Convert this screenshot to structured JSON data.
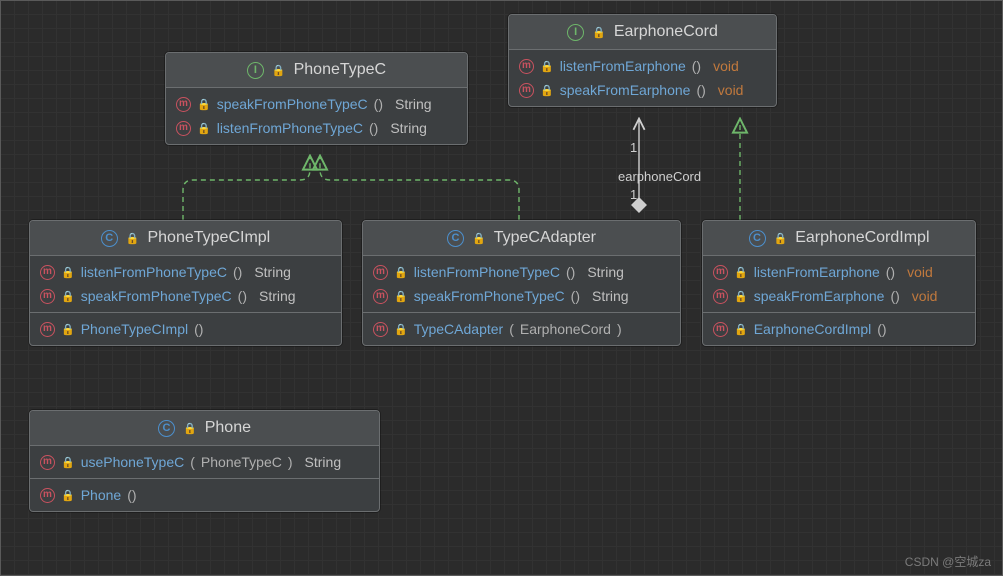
{
  "watermark": "CSDN @空城za",
  "relations": {
    "earphoneCord_label": "earphoneCord",
    "mult1": "1",
    "mult2": "1"
  },
  "classes": {
    "PhoneTypeC": {
      "name": "PhoneTypeC",
      "kind": "interface",
      "methods1": [
        {
          "name": "speakFromPhoneTypeC",
          "params": "()",
          "ret": "String"
        },
        {
          "name": "listenFromPhoneTypeC",
          "params": "()",
          "ret": "String"
        }
      ]
    },
    "EarphoneCord": {
      "name": "EarphoneCord",
      "kind": "interface",
      "methods1": [
        {
          "name": "listenFromEarphone",
          "params": "()",
          "ret": "void"
        },
        {
          "name": "speakFromEarphone",
          "params": "()",
          "ret": "void"
        }
      ]
    },
    "PhoneTypeCImpl": {
      "name": "PhoneTypeCImpl",
      "kind": "class",
      "methods1": [
        {
          "name": "listenFromPhoneTypeC",
          "params": "()",
          "ret": "String"
        },
        {
          "name": "speakFromPhoneTypeC",
          "params": "()",
          "ret": "String"
        }
      ],
      "methods2": [
        {
          "name": "PhoneTypeCImpl",
          "params": "()",
          "ret": ""
        }
      ]
    },
    "TypeCAdapter": {
      "name": "TypeCAdapter",
      "kind": "class",
      "methods1": [
        {
          "name": "listenFromPhoneTypeC",
          "params": "()",
          "ret": "String"
        },
        {
          "name": "speakFromPhoneTypeC",
          "params": "()",
          "ret": "String"
        }
      ],
      "methods2": [
        {
          "name": "TypeCAdapter",
          "params_pre": "(",
          "params_type": "EarphoneCord",
          "params_post": ")",
          "ret": ""
        }
      ]
    },
    "EarphoneCordImpl": {
      "name": "EarphoneCordImpl",
      "kind": "class",
      "methods1": [
        {
          "name": "listenFromEarphone",
          "params": "()",
          "ret": "void"
        },
        {
          "name": "speakFromEarphone",
          "params": "()",
          "ret": "void"
        }
      ],
      "methods2": [
        {
          "name": "EarphoneCordImpl",
          "params": "()",
          "ret": ""
        }
      ]
    },
    "Phone": {
      "name": "Phone",
      "kind": "class",
      "methods1": [
        {
          "name": "usePhoneTypeC",
          "params_pre": "(",
          "params_type": "PhoneTypeC",
          "params_post": ")",
          "ret": "String"
        }
      ],
      "methods2": [
        {
          "name": "Phone",
          "params": "()",
          "ret": ""
        }
      ]
    }
  }
}
